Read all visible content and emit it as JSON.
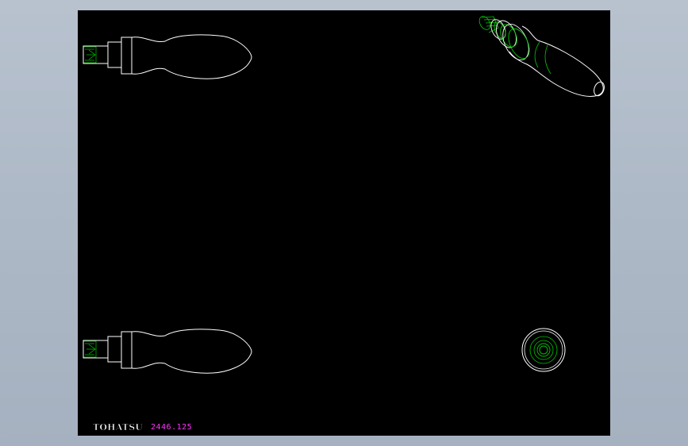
{
  "titleblock": {
    "brand_logo": "TOHATSU",
    "part_number": "2446.125"
  },
  "colors": {
    "background": "#000000",
    "outline": "#ffffff",
    "hidden": "#00c800",
    "part_number": "#ff33ff",
    "frame": "#b4bfcd"
  },
  "views": [
    {
      "name": "top-side-view"
    },
    {
      "name": "bottom-side-view"
    },
    {
      "name": "isometric-view"
    },
    {
      "name": "end-view"
    }
  ]
}
